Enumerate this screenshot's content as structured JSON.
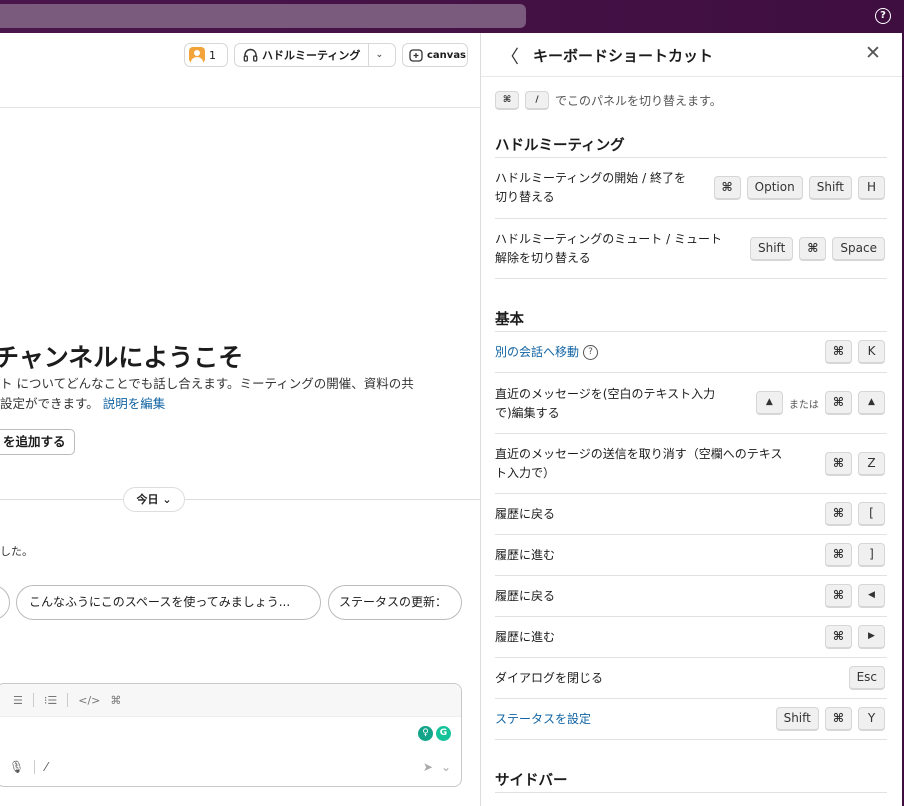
{
  "topbar": {
    "help_icon": "?"
  },
  "header": {
    "member_count": "1",
    "huddle_label": "ハドルミーティング",
    "huddle_caret": "⌄",
    "canvas_label": "canvas"
  },
  "welcome": {
    "title": "チャンネルにようこそ",
    "desc_line1": "ト についてどんなことでも話し合えます。ミーティングの開催、資料の共",
    "desc_line2_text": "設定ができます。",
    "edit_link": "説明を編集",
    "add_button": "を追加する"
  },
  "timeline": {
    "today": "今日",
    "today_caret": "⌄",
    "joined_text": "した。"
  },
  "chips": [
    {
      "label": ""
    },
    {
      "label": "こんなふうにこのスペースを使ってみましょう..."
    },
    {
      "label": "ステータスの更新："
    }
  ],
  "composer": {
    "toolbar": [
      "☰",
      "⁝☰",
      "</>",
      "⌘"
    ],
    "grammarly": [
      "♀",
      "G"
    ],
    "bottom": [
      "🎙",
      "⁄"
    ],
    "send_icon": "➤",
    "send_caret": "⌄"
  },
  "panel": {
    "title": "キーボードショートカット",
    "back_icon": "〈",
    "close_icon": "✕",
    "toggle_keys": [
      "⌘",
      "/"
    ],
    "toggle_text": "でこのパネルを切り替えます。",
    "sections": [
      {
        "title": "ハドルミーティング",
        "rows": [
          {
            "label1": "ハドルミーティングの開始 / 終了を",
            "label2": "切り替える",
            "keys": [
              "⌘",
              "Option",
              "Shift",
              "H"
            ]
          },
          {
            "label1": "ハドルミーティングのミュート / ミュート",
            "label2": "解除を切り替える",
            "keys": [
              "Shift",
              "⌘",
              "Space"
            ]
          }
        ]
      },
      {
        "title": "基本",
        "rows": [
          {
            "label1": "別の会話へ移動",
            "keys": [
              "⌘",
              "K"
            ]
          },
          {
            "label1": "直近のメッセージを(空白のテキスト入力",
            "label2": "で)編集する",
            "keys_alt": [
              "▲"
            ],
            "or_text": "または",
            "keys": [
              "⌘",
              "▲"
            ]
          },
          {
            "label1": "直近のメッセージの送信を取り消す（空欄へのテキス",
            "label2": "ト入力で）",
            "keys": [
              "⌘",
              "Z"
            ]
          },
          {
            "label1": "履歴に戻る",
            "keys": [
              "⌘",
              "["
            ]
          },
          {
            "label1": "履歴に進む",
            "keys": [
              "⌘",
              "]"
            ]
          },
          {
            "label1": "履歴に戻る",
            "keys": [
              "⌘",
              "◀"
            ]
          },
          {
            "label1": "履歴に進む",
            "keys": [
              "⌘",
              "▶"
            ]
          },
          {
            "label1": "ダイアログを閉じる",
            "keys": [
              "Esc"
            ]
          },
          {
            "label1": "ステータスを設定",
            "keys": [
              "Shift",
              "⌘",
              "Y"
            ]
          }
        ]
      },
      {
        "title": "サイドバー"
      }
    ]
  }
}
